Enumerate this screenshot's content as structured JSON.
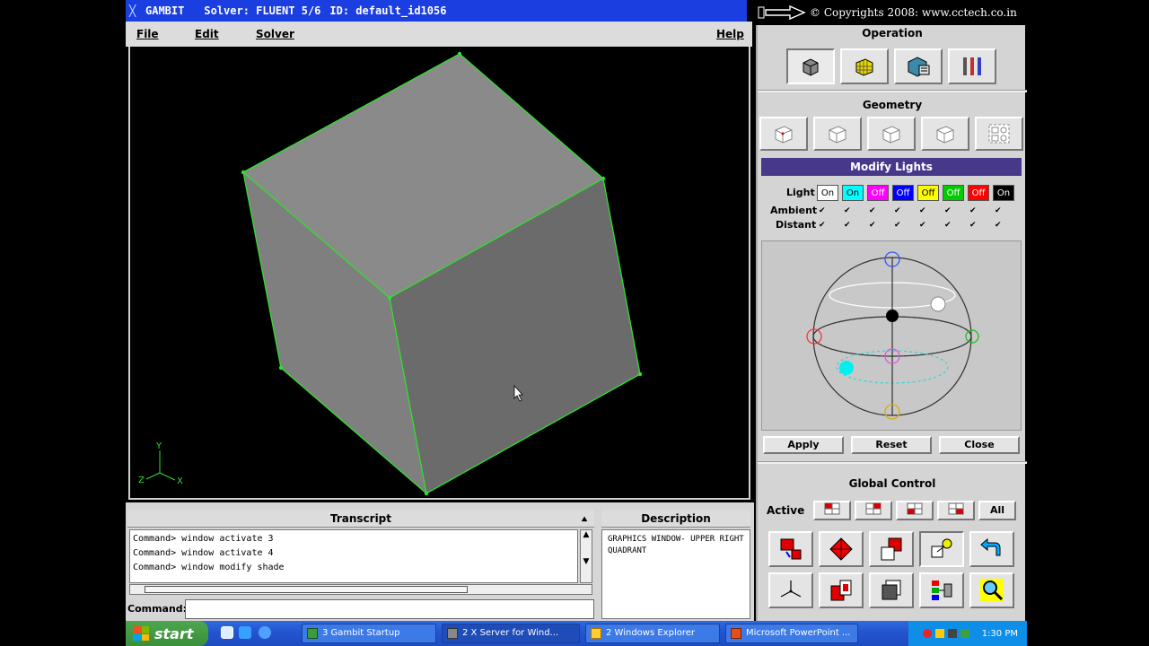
{
  "titlebar": {
    "app": "GAMBIT",
    "solver": "Solver: FLUENT 5/6",
    "id": "ID: default_id1056"
  },
  "copyright": "© Copyrights 2008: www.cctech.co.in",
  "menu": {
    "file": "File",
    "edit": "Edit",
    "solver": "Solver",
    "help": "Help"
  },
  "transcript": {
    "title": "Transcript",
    "lines": [
      "Command> window activate 3",
      "Command> window activate 4",
      "Command> window modify shade"
    ]
  },
  "command": {
    "label": "Command:",
    "value": ""
  },
  "description": {
    "title": "Description",
    "text": "GRAPHICS WINDOW- UPPER RIGHT QUADRANT"
  },
  "panel": {
    "operation": "Operation",
    "geometry": "Geometry",
    "modify_lights": "Modify Lights",
    "light_label": "Light",
    "ambient_label": "Ambient",
    "distant_label": "Distant",
    "lights": [
      {
        "state": "On",
        "color": "#ffffff"
      },
      {
        "state": "On",
        "color": "#00ffff"
      },
      {
        "state": "Off",
        "color": "#ff00ff"
      },
      {
        "state": "Off",
        "color": "#0000ff"
      },
      {
        "state": "Off",
        "color": "#ffff00"
      },
      {
        "state": "Off",
        "color": "#00cc00"
      },
      {
        "state": "Off",
        "color": "#ff0000"
      },
      {
        "state": "On",
        "color": "#000000"
      }
    ],
    "apply": "Apply",
    "reset": "Reset",
    "close": "Close",
    "global_control": "Global Control",
    "active_label": "Active",
    "all": "All"
  },
  "taskbar": {
    "start": "start",
    "tasks": [
      "3 Gambit Startup",
      "2 X Server for Wind...",
      "2 Windows Explorer",
      "Microsoft PowerPoint ..."
    ],
    "clock": "1:30 PM"
  },
  "axis": {
    "y": "Y",
    "x": "X",
    "z": "Z"
  }
}
